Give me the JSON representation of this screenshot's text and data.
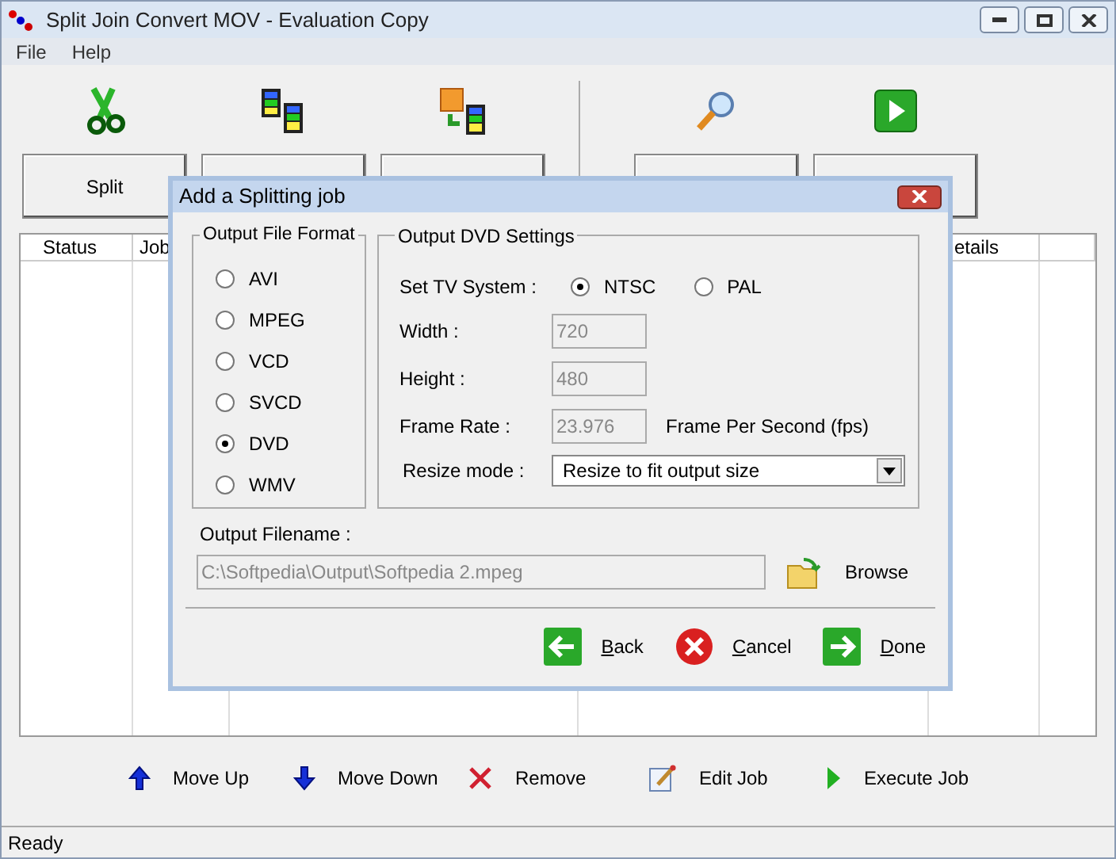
{
  "window": {
    "title": "Split Join Convert MOV - Evaluation Copy"
  },
  "menu": [
    "File",
    "Help"
  ],
  "toolbar": [
    {
      "kind": "split",
      "label": "Split"
    },
    {
      "kind": "join"
    },
    {
      "kind": "convert"
    },
    {
      "kind": "preview"
    },
    {
      "kind": "execute"
    }
  ],
  "table": {
    "columns": [
      "Status",
      "Job",
      "etails"
    ]
  },
  "dialog": {
    "title": "Add a Splitting job",
    "format_group": {
      "title": "Output File Format",
      "options": [
        {
          "label": "AVI",
          "selected": false
        },
        {
          "label": "MPEG",
          "selected": false
        },
        {
          "label": "VCD",
          "selected": false
        },
        {
          "label": "SVCD",
          "selected": false
        },
        {
          "label": "DVD",
          "selected": true
        },
        {
          "label": "WMV",
          "selected": false
        }
      ]
    },
    "dvd_group": {
      "title": "Output DVD Settings",
      "tv_label": "Set TV System :",
      "tv_options": [
        {
          "label": "NTSC",
          "selected": true
        },
        {
          "label": "PAL",
          "selected": false
        }
      ],
      "fields": [
        {
          "label": "Width :",
          "value": "720",
          "disabled": true
        },
        {
          "label": "Height :",
          "value": "480",
          "disabled": true
        },
        {
          "label": "Frame Rate :",
          "value": "23.976",
          "disabled": true,
          "unit": "Frame Per Second (fps)"
        }
      ],
      "resize": {
        "label": "Resize mode :",
        "value": "Resize to fit output size"
      }
    },
    "filename": {
      "label": "Output Filename :",
      "value": "C:\\Softpedia\\Output\\Softpedia 2.mpeg",
      "disabled": true
    },
    "browse": "Browse",
    "buttons": [
      {
        "kind": "back",
        "label": "Back"
      },
      {
        "kind": "cancel",
        "label": "Cancel"
      },
      {
        "kind": "done",
        "label": "Done"
      }
    ]
  },
  "actions": [
    {
      "kind": "up",
      "label": "Move Up"
    },
    {
      "kind": "down",
      "label": "Move Down"
    },
    {
      "kind": "remove",
      "label": "Remove"
    },
    {
      "kind": "edit",
      "label": "Edit Job"
    },
    {
      "kind": "execute",
      "label": "Execute Job"
    }
  ],
  "status_bar": "Ready"
}
